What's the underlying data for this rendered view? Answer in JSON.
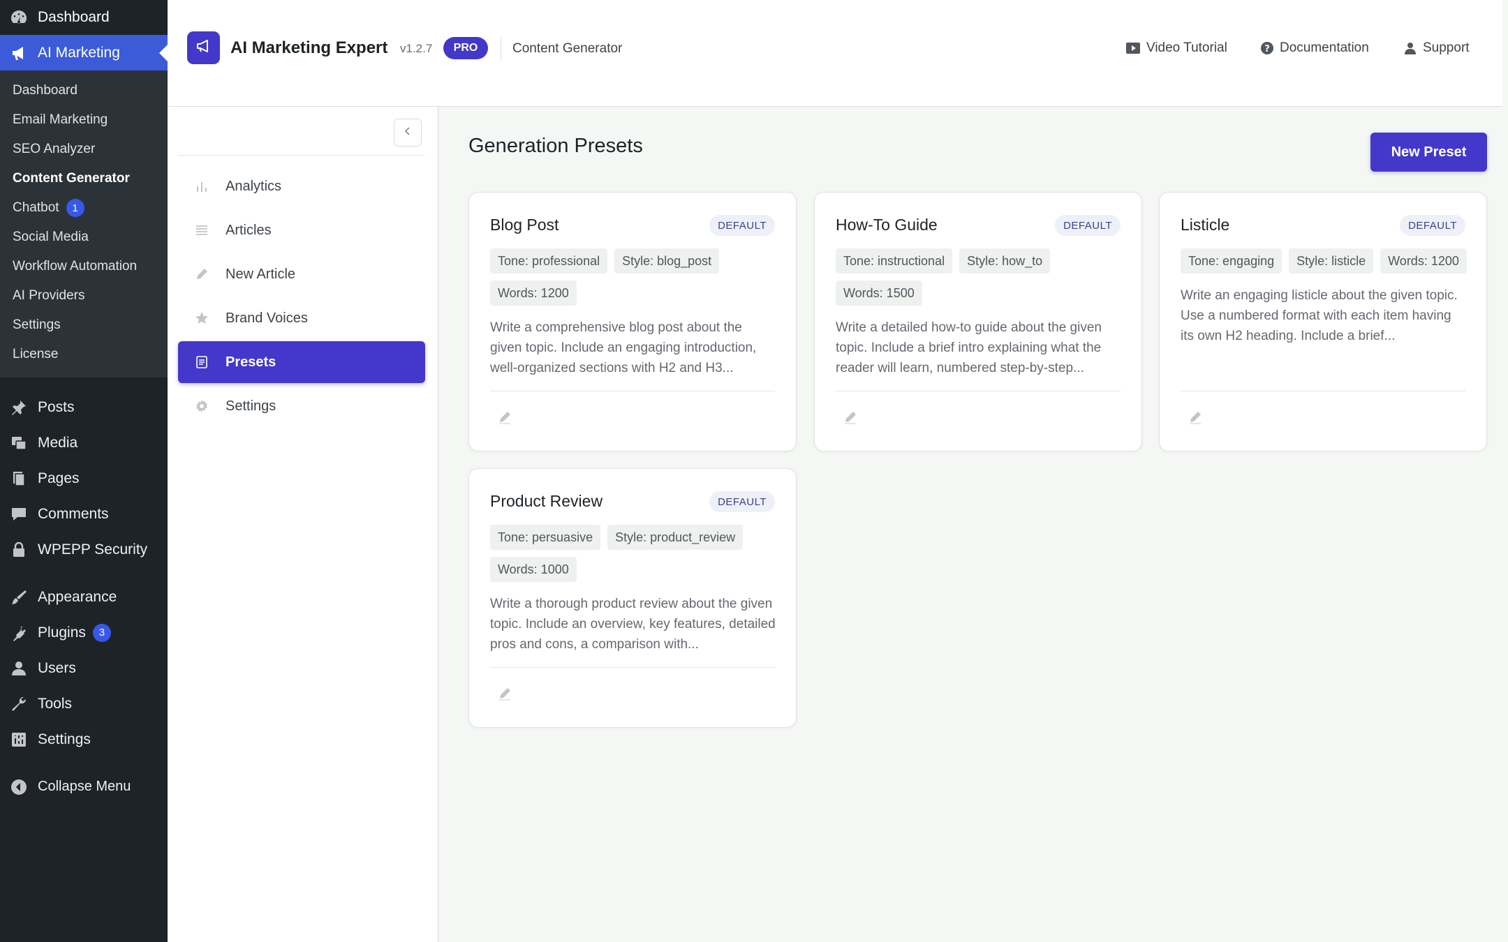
{
  "wp_menu": {
    "top": [
      {
        "label": "Dashboard",
        "icon": "dashboard-icon"
      }
    ],
    "active": {
      "label": "AI Marketing",
      "icon": "megaphone-icon"
    },
    "submenu": [
      {
        "label": "Dashboard"
      },
      {
        "label": "Email Marketing"
      },
      {
        "label": "SEO Analyzer"
      },
      {
        "label": "Content Generator",
        "current": true
      },
      {
        "label": "Chatbot",
        "badge": "1"
      },
      {
        "label": "Social Media"
      },
      {
        "label": "Workflow Automation"
      },
      {
        "label": "AI Providers"
      },
      {
        "label": "Settings"
      },
      {
        "label": "License"
      }
    ],
    "group1": [
      {
        "label": "Posts",
        "icon": "pin-icon"
      },
      {
        "label": "Media",
        "icon": "media-icon"
      },
      {
        "label": "Pages",
        "icon": "pages-icon"
      },
      {
        "label": "Comments",
        "icon": "comments-icon"
      },
      {
        "label": "WPEPP Security",
        "icon": "lock-icon"
      }
    ],
    "group2": [
      {
        "label": "Appearance",
        "icon": "brush-icon"
      },
      {
        "label": "Plugins",
        "icon": "plug-icon",
        "badge": "3"
      },
      {
        "label": "Users",
        "icon": "user-icon"
      },
      {
        "label": "Tools",
        "icon": "wrench-icon"
      },
      {
        "label": "Settings",
        "icon": "settings-icon"
      }
    ],
    "collapse": {
      "label": "Collapse Menu",
      "icon": "collapse-icon"
    }
  },
  "header": {
    "title": "AI Marketing Expert",
    "version": "v1.2.7",
    "badge": "PRO",
    "section": "Content Generator",
    "links": {
      "video": "Video Tutorial",
      "docs": "Documentation",
      "support": "Support"
    }
  },
  "plugin_nav": [
    {
      "label": "Analytics",
      "icon": "chart-icon"
    },
    {
      "label": "Articles",
      "icon": "list-icon"
    },
    {
      "label": "New Article",
      "icon": "pencil-icon"
    },
    {
      "label": "Brand Voices",
      "icon": "star-icon"
    },
    {
      "label": "Presets",
      "icon": "document-icon",
      "active": true
    },
    {
      "label": "Settings",
      "icon": "gear-icon"
    }
  ],
  "main": {
    "title": "Generation Presets",
    "new_button": "New Preset",
    "default_label": "DEFAULT",
    "presets": [
      {
        "name": "Blog Post",
        "tags": [
          "Tone: professional",
          "Style: blog_post",
          "Words: 1200"
        ],
        "description": "Write a comprehensive blog post about the given topic. Include an engaging introduction, well-organized sections with H2 and H3..."
      },
      {
        "name": "How-To Guide",
        "tags": [
          "Tone: instructional",
          "Style: how_to",
          "Words: 1500"
        ],
        "description": "Write a detailed how-to guide about the given topic. Include a brief intro explaining what the reader will learn, numbered step-by-step..."
      },
      {
        "name": "Listicle",
        "tags": [
          "Tone: engaging",
          "Style: listicle",
          "Words: 1200"
        ],
        "description": "Write an engaging listicle about the given topic. Use a numbered format with each item having its own H2 heading. Include a brief..."
      },
      {
        "name": "Product Review",
        "tags": [
          "Tone: persuasive",
          "Style: product_review",
          "Words: 1000"
        ],
        "description": "Write a thorough product review about the given topic. Include an overview, key features, detailed pros and cons, a comparison with..."
      }
    ]
  },
  "colors": {
    "accent": "#4338ca",
    "wp_active": "#3c5bd8",
    "wp_sidebar": "#1d2327"
  }
}
